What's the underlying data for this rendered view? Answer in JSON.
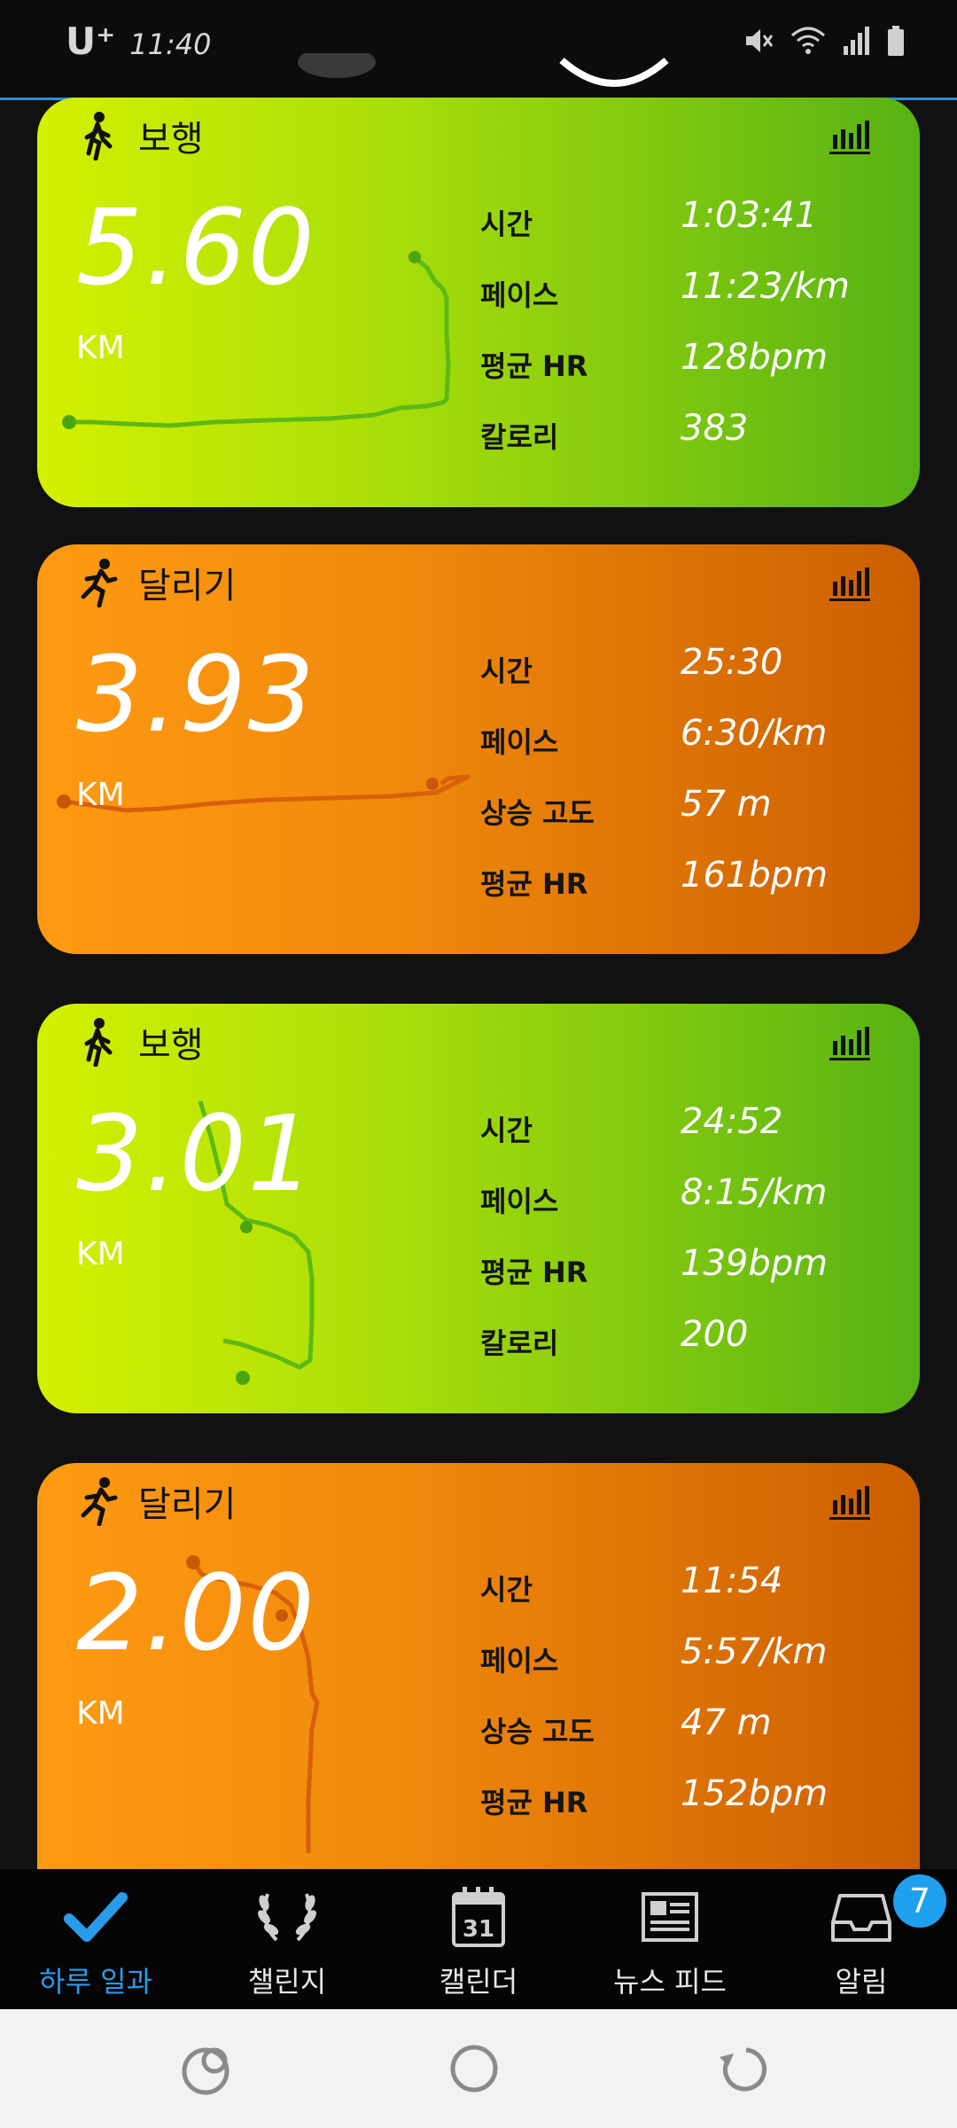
{
  "status_bar": {
    "carrier": "U⁺",
    "time": "11:40",
    "icons": [
      "mute-icon",
      "wifi-icon",
      "signal-icon",
      "battery-icon"
    ]
  },
  "cards": [
    {
      "type": "walk",
      "activity": "보행",
      "distance": "5.60",
      "unit": "KM",
      "metrics": [
        {
          "label": "시간",
          "value": "1:03:41"
        },
        {
          "label": "페이스",
          "value": "11:23/km"
        },
        {
          "label": "평균 HR",
          "value": "128bpm"
        },
        {
          "label": "칼로리",
          "value": "383"
        }
      ]
    },
    {
      "type": "run",
      "activity": "달리기",
      "distance": "3.93",
      "unit": "KM",
      "metrics": [
        {
          "label": "시간",
          "value": "25:30"
        },
        {
          "label": "페이스",
          "value": "6:30/km"
        },
        {
          "label": "상승 고도",
          "value": "57 m"
        },
        {
          "label": "평균 HR",
          "value": "161bpm"
        }
      ]
    },
    {
      "type": "walk",
      "activity": "보행",
      "distance": "3.01",
      "unit": "KM",
      "metrics": [
        {
          "label": "시간",
          "value": "24:52"
        },
        {
          "label": "페이스",
          "value": "8:15/km"
        },
        {
          "label": "평균 HR",
          "value": "139bpm"
        },
        {
          "label": "칼로리",
          "value": "200"
        }
      ]
    },
    {
      "type": "run",
      "activity": "달리기",
      "distance": "2.00",
      "unit": "KM",
      "metrics": [
        {
          "label": "시간",
          "value": "11:54"
        },
        {
          "label": "페이스",
          "value": "5:57/km"
        },
        {
          "label": "상승 고도",
          "value": "47 m"
        },
        {
          "label": "평균 HR",
          "value": "152bpm"
        }
      ]
    }
  ],
  "bottom_nav": {
    "items": [
      {
        "label": "하루 일과",
        "icon": "checkmark-icon",
        "active": true
      },
      {
        "label": "챌린지",
        "icon": "laurel-icon",
        "active": false
      },
      {
        "label": "캘린더",
        "icon": "calendar-icon",
        "calendar_day": "31",
        "active": false
      },
      {
        "label": "뉴스 피드",
        "icon": "newspaper-icon",
        "active": false
      },
      {
        "label": "알림",
        "icon": "inbox-icon",
        "badge": "7",
        "active": false
      }
    ]
  },
  "system_nav": [
    "recents-icon",
    "home-icon",
    "back-icon"
  ],
  "colors": {
    "walk_start": "#d4f000",
    "walk_end": "#57b214",
    "run_start": "#ff9a12",
    "run_end": "#cc5e00",
    "accent": "#2a9be8"
  }
}
